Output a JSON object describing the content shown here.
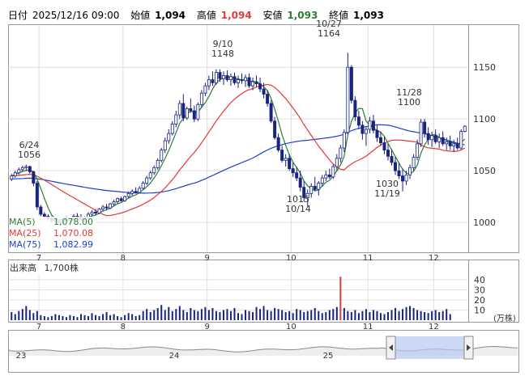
{
  "header": {
    "date_label": "日付",
    "date_value": "2025/12/16 09:00",
    "open_label": "始値",
    "open_value": "1,094",
    "high_label": "高値",
    "high_value": "1,094",
    "low_label": "安値",
    "low_value": "1,093",
    "close_label": "終値",
    "close_value": "1,093"
  },
  "colors": {
    "up": "#ffffff",
    "down": "#1a237e",
    "ma5": "#2e7d32",
    "ma25": "#e53935",
    "ma75": "#1e3fd0",
    "volume": "#1a237e",
    "volume_spike": "#e53935",
    "high_value": "#e53935",
    "low_value": "#2e7d32"
  },
  "legend": {
    "ma5": "MA(5)",
    "ma5_value": "1,078.00",
    "ma25": "MA(25)",
    "ma25_value": "1,070.08",
    "ma75": "MA(75)",
    "ma75_value": "1,082.99"
  },
  "volume_panel": {
    "title": "出来高",
    "value": "1,700株",
    "unit": "(万株)",
    "ticks": [
      "40",
      "30",
      "20",
      "10"
    ]
  },
  "navigator": {
    "labels": [
      "23",
      "24",
      "25"
    ]
  },
  "chart_data": {
    "type": "candlestick",
    "y_ticks": [
      1000,
      1050,
      1100,
      1150
    ],
    "ylim": [
      972,
      1190
    ],
    "x_month_labels": [
      "7",
      "8",
      "9",
      "10",
      "11",
      "12"
    ],
    "annotations": [
      {
        "date": "6/24",
        "value": "1056"
      },
      {
        "date": "9/10",
        "value": "1148"
      },
      {
        "date": "10/27",
        "value": "1164"
      },
      {
        "date": "11/28",
        "value": "1100"
      },
      {
        "date": "10/14",
        "value": "1015"
      },
      {
        "date": "11/19",
        "value": "1030"
      }
    ],
    "candles": [
      [
        1042,
        1047,
        1040,
        1045
      ],
      [
        1045,
        1050,
        1043,
        1048
      ],
      [
        1048,
        1053,
        1046,
        1051
      ],
      [
        1051,
        1055,
        1049,
        1053
      ],
      [
        1053,
        1056,
        1050,
        1054
      ],
      [
        1054,
        1055,
        1047,
        1049
      ],
      [
        1049,
        1050,
        1035,
        1038
      ],
      [
        1038,
        1040,
        1012,
        1015
      ],
      [
        1015,
        1017,
        1006,
        1008
      ],
      [
        1008,
        1010,
        1004,
        1006
      ],
      [
        1006,
        1008,
        1002,
        1004
      ],
      [
        1004,
        1006,
        1000,
        1002
      ],
      [
        1002,
        1004,
        999,
        1001
      ],
      [
        1001,
        1003,
        998,
        1000
      ],
      [
        1000,
        1004,
        998,
        1003
      ],
      [
        1003,
        1006,
        1001,
        1002
      ],
      [
        1002,
        1005,
        999,
        1004
      ],
      [
        1004,
        1008,
        1002,
        1006
      ],
      [
        1006,
        1009,
        1003,
        1005
      ],
      [
        1005,
        1008,
        1001,
        1003
      ],
      [
        1003,
        1006,
        1000,
        1005
      ],
      [
        1005,
        1010,
        1004,
        1008
      ],
      [
        1008,
        1012,
        1006,
        1010
      ],
      [
        1010,
        1013,
        1007,
        1009
      ],
      [
        1009,
        1014,
        1008,
        1013
      ],
      [
        1013,
        1017,
        1011,
        1015
      ],
      [
        1015,
        1018,
        1012,
        1014
      ],
      [
        1014,
        1019,
        1013,
        1018
      ],
      [
        1018,
        1022,
        1016,
        1020
      ],
      [
        1020,
        1024,
        1018,
        1023
      ],
      [
        1023,
        1025,
        1020,
        1021
      ],
      [
        1021,
        1026,
        1020,
        1025
      ],
      [
        1025,
        1030,
        1024,
        1028
      ],
      [
        1028,
        1032,
        1026,
        1030
      ],
      [
        1030,
        1034,
        1028,
        1029
      ],
      [
        1029,
        1035,
        1028,
        1033
      ],
      [
        1033,
        1040,
        1032,
        1038
      ],
      [
        1038,
        1045,
        1036,
        1043
      ],
      [
        1043,
        1050,
        1041,
        1048
      ],
      [
        1048,
        1055,
        1046,
        1053
      ],
      [
        1053,
        1062,
        1051,
        1060
      ],
      [
        1060,
        1072,
        1058,
        1070
      ],
      [
        1070,
        1082,
        1067,
        1079
      ],
      [
        1079,
        1090,
        1076,
        1086
      ],
      [
        1086,
        1098,
        1084,
        1095
      ],
      [
        1095,
        1108,
        1092,
        1104
      ],
      [
        1104,
        1118,
        1100,
        1115
      ],
      [
        1115,
        1124,
        1098,
        1101
      ],
      [
        1101,
        1112,
        1099,
        1110
      ],
      [
        1110,
        1120,
        1106,
        1108
      ],
      [
        1108,
        1113,
        1097,
        1100
      ],
      [
        1100,
        1116,
        1098,
        1114
      ],
      [
        1114,
        1128,
        1111,
        1125
      ],
      [
        1125,
        1135,
        1122,
        1132
      ],
      [
        1132,
        1142,
        1128,
        1138
      ],
      [
        1138,
        1146,
        1132,
        1135
      ],
      [
        1135,
        1148,
        1133,
        1145
      ],
      [
        1145,
        1148,
        1136,
        1139
      ],
      [
        1139,
        1146,
        1133,
        1142
      ],
      [
        1142,
        1147,
        1136,
        1138
      ],
      [
        1138,
        1144,
        1132,
        1141
      ],
      [
        1141,
        1145,
        1133,
        1135
      ],
      [
        1135,
        1142,
        1130,
        1138
      ],
      [
        1138,
        1144,
        1134,
        1137
      ],
      [
        1137,
        1143,
        1131,
        1140
      ],
      [
        1140,
        1144,
        1130,
        1132
      ],
      [
        1132,
        1140,
        1128,
        1136
      ],
      [
        1136,
        1142,
        1131,
        1134
      ],
      [
        1134,
        1140,
        1126,
        1129
      ],
      [
        1129,
        1135,
        1120,
        1124
      ],
      [
        1124,
        1128,
        1112,
        1115
      ],
      [
        1115,
        1118,
        1096,
        1098
      ],
      [
        1098,
        1102,
        1080,
        1082
      ],
      [
        1082,
        1086,
        1068,
        1070
      ],
      [
        1070,
        1074,
        1058,
        1060
      ],
      [
        1060,
        1066,
        1054,
        1062
      ],
      [
        1062,
        1066,
        1050,
        1052
      ],
      [
        1052,
        1058,
        1044,
        1048
      ],
      [
        1048,
        1054,
        1040,
        1043
      ],
      [
        1043,
        1050,
        1030,
        1034
      ],
      [
        1034,
        1040,
        1020,
        1024
      ],
      [
        1024,
        1032,
        1015,
        1028
      ],
      [
        1028,
        1038,
        1024,
        1035
      ],
      [
        1035,
        1044,
        1030,
        1032
      ],
      [
        1032,
        1040,
        1026,
        1038
      ],
      [
        1038,
        1046,
        1035,
        1043
      ],
      [
        1043,
        1050,
        1040,
        1046
      ],
      [
        1046,
        1052,
        1042,
        1044
      ],
      [
        1044,
        1056,
        1042,
        1054
      ],
      [
        1054,
        1066,
        1050,
        1062
      ],
      [
        1062,
        1075,
        1058,
        1072
      ],
      [
        1072,
        1090,
        1068,
        1087
      ],
      [
        1087,
        1164,
        1085,
        1150
      ],
      [
        1150,
        1152,
        1115,
        1118
      ],
      [
        1118,
        1122,
        1098,
        1102
      ],
      [
        1102,
        1108,
        1090,
        1094
      ],
      [
        1094,
        1098,
        1080,
        1086
      ],
      [
        1086,
        1092,
        1074,
        1090
      ],
      [
        1090,
        1102,
        1086,
        1098
      ],
      [
        1098,
        1104,
        1086,
        1089
      ],
      [
        1089,
        1094,
        1078,
        1082
      ],
      [
        1082,
        1088,
        1074,
        1077
      ],
      [
        1077,
        1083,
        1066,
        1070
      ],
      [
        1070,
        1076,
        1060,
        1064
      ],
      [
        1064,
        1070,
        1055,
        1058
      ],
      [
        1058,
        1064,
        1046,
        1050
      ],
      [
        1050,
        1058,
        1042,
        1045
      ],
      [
        1045,
        1052,
        1030,
        1040
      ],
      [
        1040,
        1050,
        1036,
        1046
      ],
      [
        1046,
        1056,
        1042,
        1053
      ],
      [
        1053,
        1066,
        1050,
        1063
      ],
      [
        1063,
        1080,
        1060,
        1076
      ],
      [
        1076,
        1100,
        1073,
        1097
      ],
      [
        1097,
        1100,
        1082,
        1086
      ],
      [
        1086,
        1092,
        1075,
        1080
      ],
      [
        1080,
        1088,
        1073,
        1084
      ],
      [
        1084,
        1090,
        1076,
        1078
      ],
      [
        1078,
        1086,
        1072,
        1082
      ],
      [
        1082,
        1088,
        1074,
        1076
      ],
      [
        1076,
        1082,
        1070,
        1078
      ],
      [
        1078,
        1084,
        1070,
        1074
      ],
      [
        1074,
        1080,
        1068,
        1076
      ],
      [
        1076,
        1082,
        1070,
        1072
      ],
      [
        1072,
        1090,
        1070,
        1088
      ],
      [
        1088,
        1094,
        1087,
        1093
      ]
    ],
    "volumes": [
      8,
      6,
      9,
      11,
      14,
      10,
      7,
      9,
      5,
      4,
      3,
      4,
      6,
      5,
      4,
      3,
      5,
      4,
      3,
      6,
      5,
      4,
      7,
      5,
      4,
      6,
      8,
      5,
      6,
      4,
      3,
      5,
      7,
      6,
      4,
      5,
      9,
      11,
      8,
      10,
      12,
      15,
      10,
      13,
      9,
      11,
      14,
      10,
      8,
      12,
      10,
      9,
      11,
      13,
      10,
      12,
      9,
      8,
      10,
      11,
      9,
      12,
      7,
      6,
      10,
      9,
      8,
      13,
      11,
      14,
      10,
      9,
      12,
      11,
      10,
      8,
      9,
      7,
      11,
      10,
      8,
      9,
      10,
      12,
      9,
      7,
      8,
      10,
      11,
      13,
      43,
      12,
      9,
      8,
      10,
      7,
      9,
      11,
      8,
      10,
      9,
      7,
      6,
      8,
      10,
      12,
      9,
      11,
      13,
      14,
      12,
      10,
      9,
      8,
      7,
      9,
      10,
      8,
      9,
      11,
      6
    ]
  }
}
